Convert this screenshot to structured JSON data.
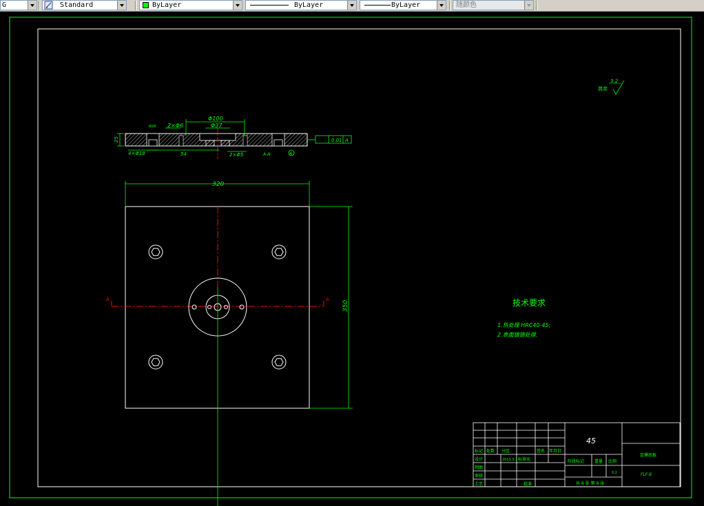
{
  "toolbar": {
    "textstyle_partial": "G",
    "dimstyle": "Standard",
    "color": "ByLayer",
    "linetype": "ByLayer",
    "lineweight": "ByLayer",
    "plotstyle": "随颜色",
    "colors": {
      "swatch": "#00ff00",
      "toolbar_bg": "#d4d0c8"
    }
  },
  "drawing": {
    "colors": {
      "background": "#000000",
      "outline": "#ffffff",
      "dimension": "#00ff00",
      "centerline": "#ff0000",
      "hatch": "#ffffff"
    },
    "section_view": {
      "dim_phi100": "Φ100",
      "dim_phi37": "Φ37",
      "dim_2xphi6": "2×Φ6",
      "dim_height": "25",
      "dim_4xphi18": "4×Φ18",
      "dim_54": "54",
      "dim_2xphi5": "2×Φ5",
      "label_sec": "A-A",
      "datum": "A",
      "tol_flatness": "0.01",
      "tol_datum": "A",
      "label_small": "Φ28"
    },
    "plan_view": {
      "dim_width": "320",
      "dim_height": "350",
      "section_mark_left": "A",
      "section_mark_right": "A"
    },
    "roughness": {
      "prefix": "其余",
      "value": "3.2"
    },
    "requirements": {
      "title": "技术要求",
      "items": [
        "1.热处理 HRC40-45;",
        "2.表面镀铬处理."
      ]
    },
    "title_block": {
      "material": "45",
      "part_name": "定模底板",
      "drawing_no": "FLF-8",
      "scale_value": "0.2",
      "col_mark": "标记",
      "col_count": "处数",
      "col_zone": "分区",
      "col_sign": "签名",
      "col_date": "年月日",
      "row_design": "设计",
      "design_date": "2013.5.3",
      "col_std": "标准化",
      "row_draw": "制图",
      "row_check": "审核",
      "row_process": "工艺",
      "row_approve": "批准",
      "stage_mark": "阶段标记",
      "weight": "重量",
      "scale": "比例",
      "sheets": "共 8 张  第 8 张"
    }
  }
}
